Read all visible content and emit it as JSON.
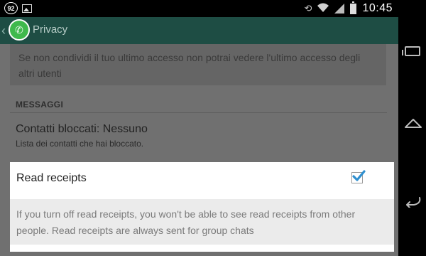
{
  "status_bar": {
    "badge": "92",
    "time": "10:45",
    "icons": [
      "notification-badge-icon",
      "image-icon",
      "rotate-icon",
      "wifi-icon",
      "signal-icon",
      "battery-icon"
    ]
  },
  "action_bar": {
    "title": "Privacy",
    "icon": "whatsapp-logo-icon",
    "color": "#1e4d44"
  },
  "last_seen_description": "Se non condividi il tuo ultimo accesso non potrai vedere l'ultimo accesso degli altri utenti",
  "messages_section": {
    "header": "MESSAGGI",
    "blocked": {
      "title": "Contatti bloccati: Nessuno",
      "subtitle": "Lista dei contatti che hai bloccato."
    }
  },
  "read_receipts": {
    "label": "Read receipts",
    "checked": true,
    "description": "If you turn off read receipts, you won't be able to see read receipts from other people. Read receipts are always sent for group chats",
    "check_color": "#2f8fcf"
  },
  "navigation": {
    "icons": [
      "recent-apps-icon",
      "home-icon",
      "back-icon"
    ]
  }
}
